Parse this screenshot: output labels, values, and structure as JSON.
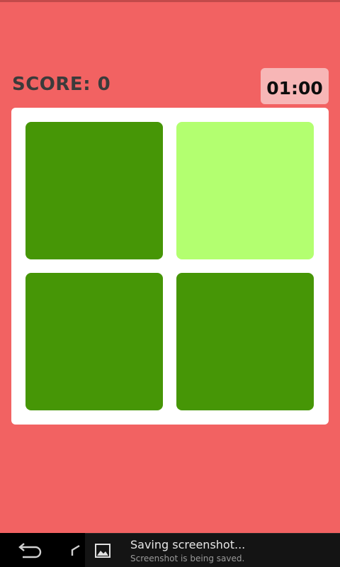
{
  "header": {
    "score_text": "SCORE: 0",
    "timer_text": "01:00"
  },
  "board": {
    "tiles": [
      {
        "color": "#469606",
        "state": "normal"
      },
      {
        "color": "#b3ff70",
        "state": "highlighted"
      },
      {
        "color": "#469606",
        "state": "normal"
      },
      {
        "color": "#469606",
        "state": "normal"
      }
    ]
  },
  "colors": {
    "background": "#f26262",
    "board": "#ffffff",
    "timer_bg": "#f7b6b6",
    "score_text": "#3b3b3b"
  },
  "system": {
    "nav_icons": [
      "back-icon",
      "home-icon"
    ],
    "notification": {
      "icon": "image-icon",
      "title": "Saving screenshot...",
      "text": "Screenshot is being saved."
    }
  }
}
